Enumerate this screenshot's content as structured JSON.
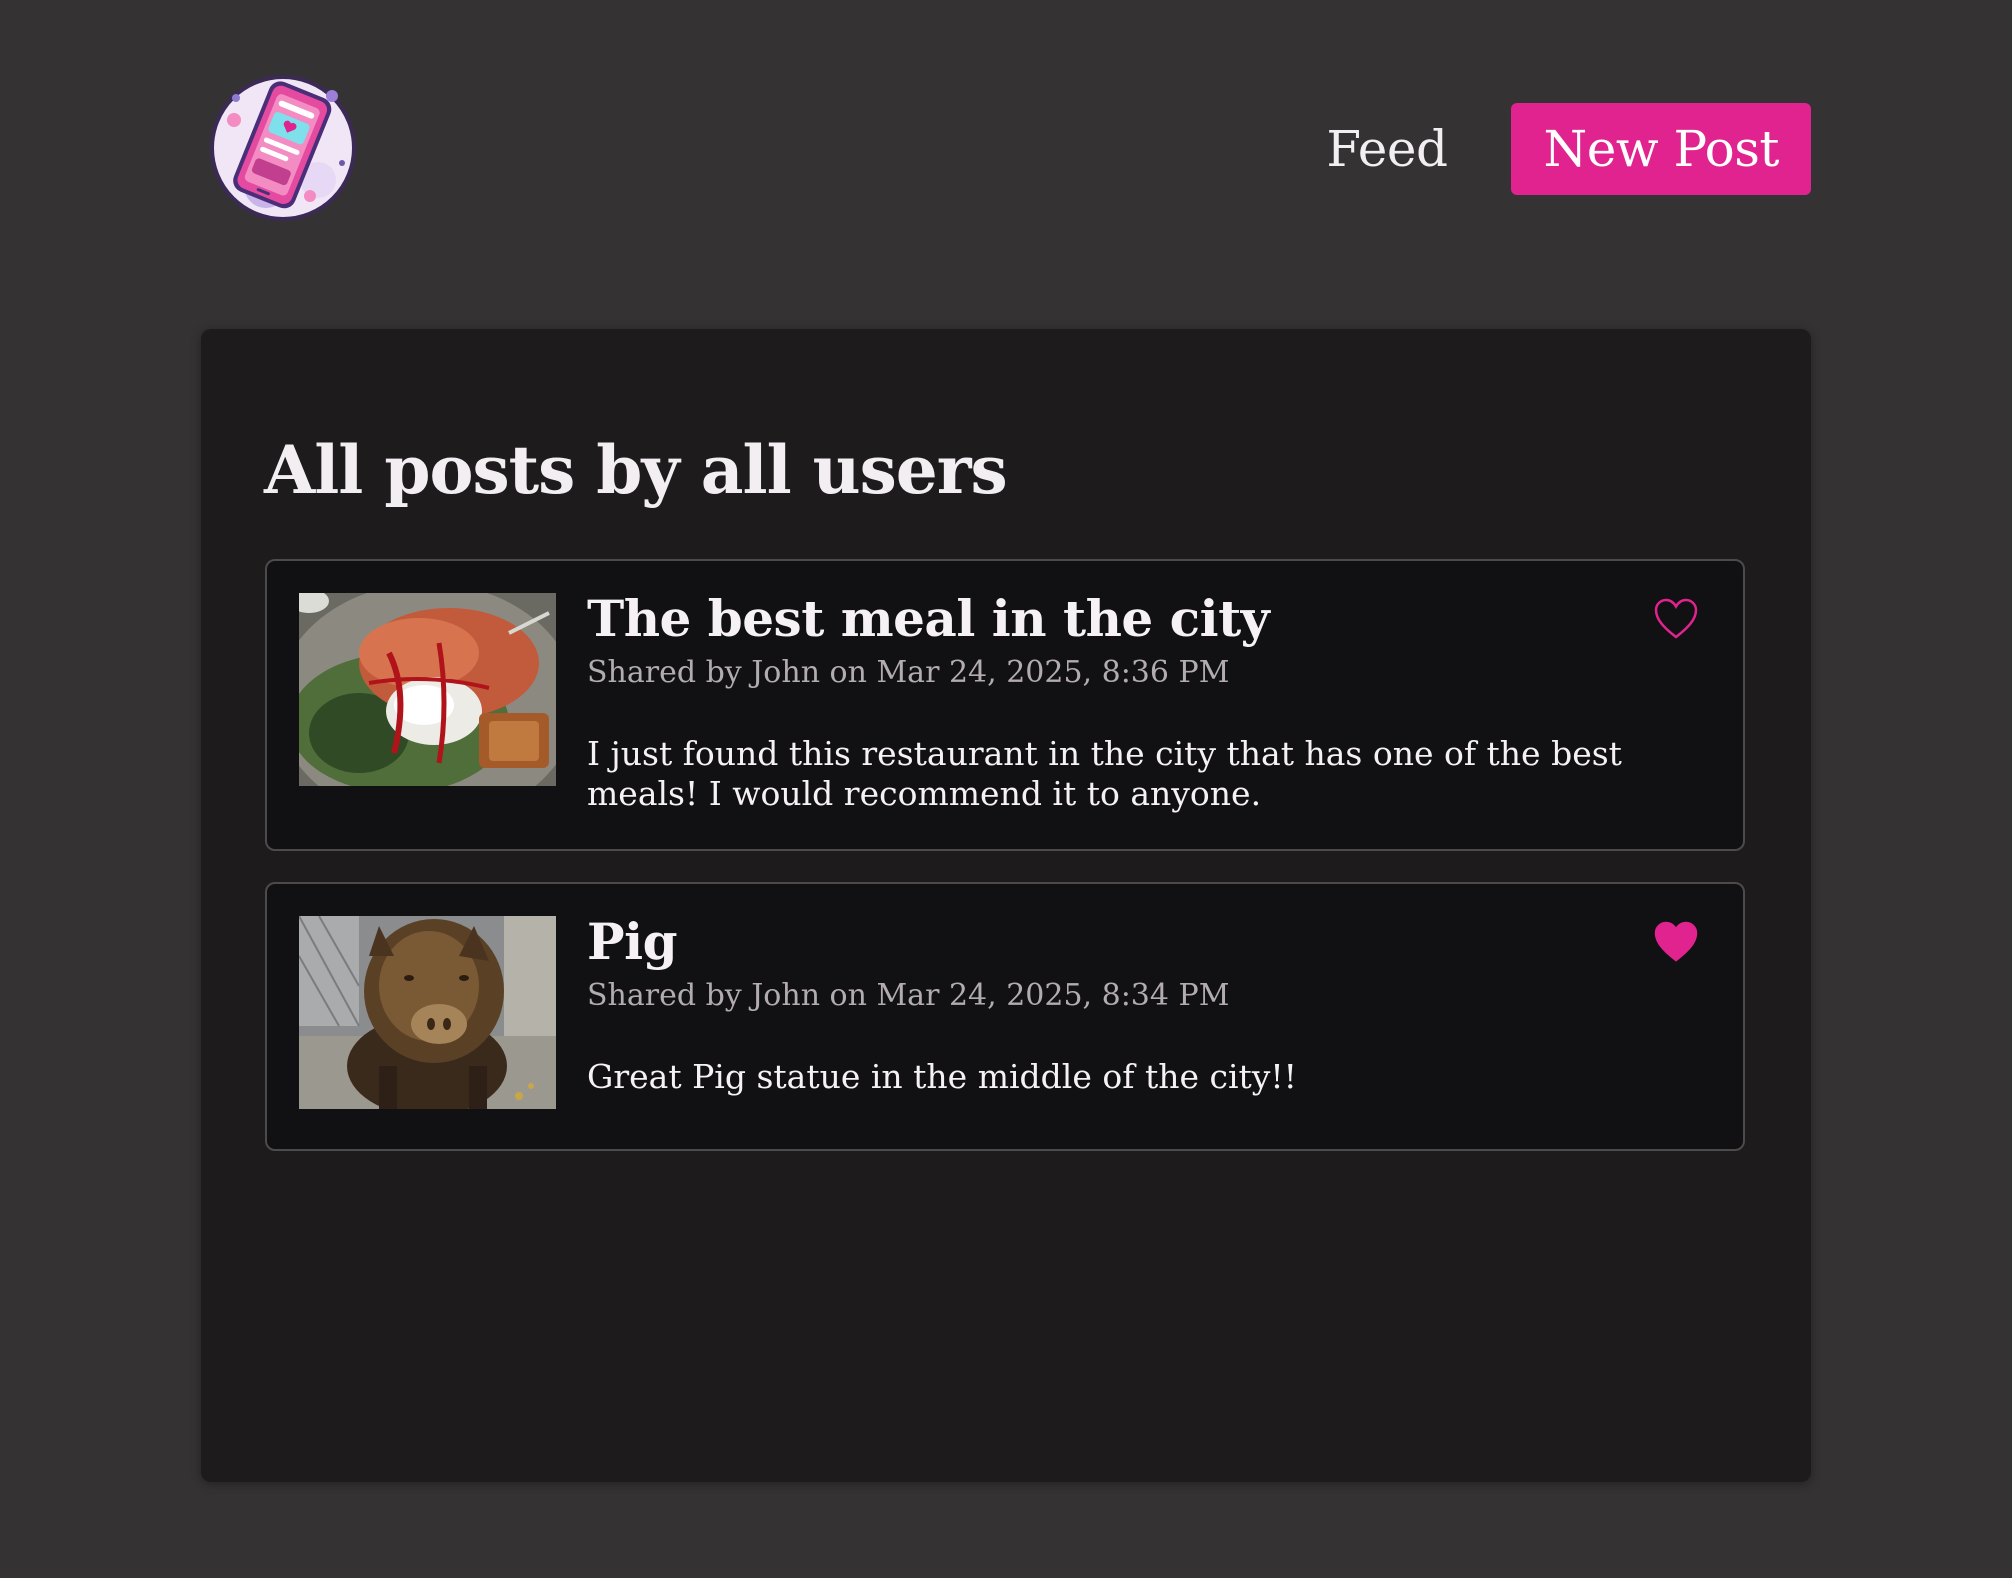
{
  "header": {
    "logo_icon": "phone-app-logo-icon",
    "nav": {
      "feed_label": "Feed",
      "new_post_label": "New Post"
    }
  },
  "colors": {
    "accent": "#e0238f",
    "page_bg": "#353234",
    "panel_bg": "#1e1b1d",
    "card_bg": "#111012"
  },
  "main": {
    "title": "All posts by all users",
    "posts": [
      {
        "title": "The best meal in the city",
        "meta": "Shared by John on Mar 24, 2025, 8:36 PM",
        "body": "I just found this restaurant in the city that has one of the best meals! I would recommend it to anyone.",
        "image_icon": "food-photo",
        "liked": false,
        "like_icon": "heart-outline-icon"
      },
      {
        "title": "Pig",
        "meta": "Shared by John on Mar 24, 2025, 8:34 PM",
        "body": "Great Pig statue in the middle of the city!!",
        "image_icon": "pig-statue-photo",
        "liked": true,
        "like_icon": "heart-filled-icon"
      }
    ]
  }
}
